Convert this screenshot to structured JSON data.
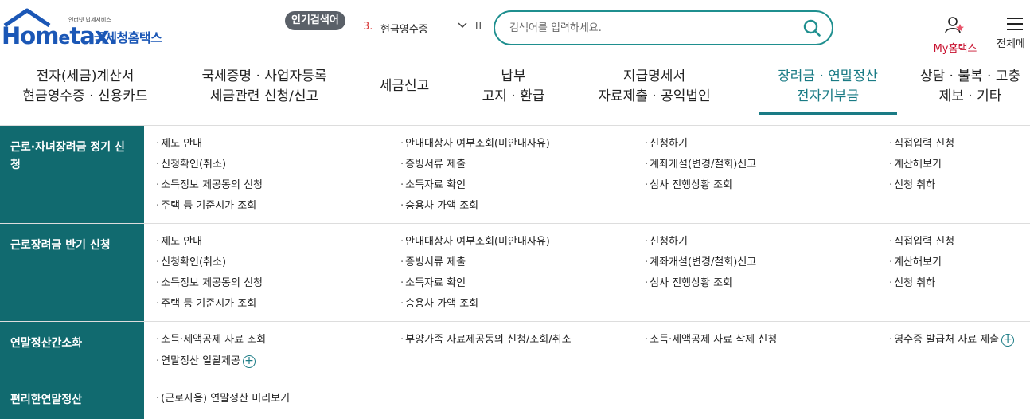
{
  "header": {
    "logo_sub": "인터넷 납세서비스",
    "logo_brand_a": "Hom",
    "logo_brand_e": "e",
    "logo_brand_b": "tax.",
    "logo_kr": "국세청홈택스",
    "popular_label": "인기검색어",
    "popular_rank": "3.",
    "popular_text": "현금영수증",
    "search_placeholder": "검색어를 입력하세요.",
    "my_home_label": "My홈택스",
    "all_menu_label": "전체메"
  },
  "gnb": [
    {
      "line1": "전자(세금)계산서",
      "line2": "현금영수증 · 신용카드"
    },
    {
      "line1": "국세증명 · 사업자등록",
      "line2": "세금관련 신청/신고"
    },
    {
      "line1": "세금신고",
      "line2": ""
    },
    {
      "line1": "납부",
      "line2": "고지 · 환급"
    },
    {
      "line1": "지급명세서",
      "line2": "자료제출 · 공익법인"
    },
    {
      "line1": "장려금 · 연말정산",
      "line2": "전자기부금"
    },
    {
      "line1": "상담 · 불복 · 고충",
      "line2": "제보 · 기타"
    }
  ],
  "sections": [
    {
      "title": "근로·자녀장려금 정기 신청",
      "links": [
        "제도 안내",
        "안내대상자 여부조회(미안내사유)",
        "신청하기",
        "직접입력 신청",
        "신청확인(취소)",
        "증빙서류 제출",
        "계좌개설(변경/철회)신고",
        "계산해보기",
        "소득정보 제공동의 신청",
        "소득자료 확인",
        "심사 진행상황 조회",
        "신청 취하",
        "주택 등 기준시가 조회",
        "승용차 가액 조회"
      ]
    },
    {
      "title": "근로장려금 반기 신청",
      "links": [
        "제도 안내",
        "안내대상자 여부조회(미안내사유)",
        "신청하기",
        "직접입력 신청",
        "신청확인(취소)",
        "증빙서류 제출",
        "계좌개설(변경/철회)신고",
        "계산해보기",
        "소득정보 제공동의 신청",
        "소득자료 확인",
        "심사 진행상황 조회",
        "신청 취하",
        "주택 등 기준시가 조회",
        "승용차 가액 조회"
      ]
    },
    {
      "title": "연말정산간소화",
      "links": [
        "소득·세액공제 자료 조회",
        "부양가족 자료제공동의 신청/조회/취소",
        "소득·세액공제 자료 삭제 신청",
        "영수증 발급처 자료 제출",
        "연말정산 일괄제공"
      ]
    },
    {
      "title": "편리한연말정산",
      "links": [
        "(근로자용) 연말정산 미리보기"
      ]
    }
  ],
  "colors": {
    "brand_blue": "#1b57b6",
    "teal": "#116a6f",
    "active_teal": "#1a7b85",
    "rank_red": "#d83a3a",
    "my_home_red": "#c8102e"
  }
}
